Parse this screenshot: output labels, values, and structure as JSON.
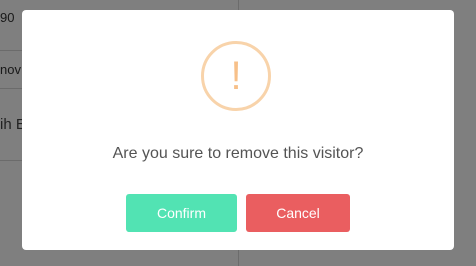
{
  "background": {
    "row1_text": "90",
    "row2_text": "nov",
    "row3_text": "ih E"
  },
  "dialog": {
    "icon": "exclamation-icon",
    "icon_glyph": "!",
    "message": "Are you sure to remove this visitor?",
    "confirm_label": "Confirm",
    "cancel_label": "Cancel"
  },
  "colors": {
    "confirm": "#52e3b3",
    "cancel": "#ea5e60",
    "warning": "#f7c089"
  }
}
